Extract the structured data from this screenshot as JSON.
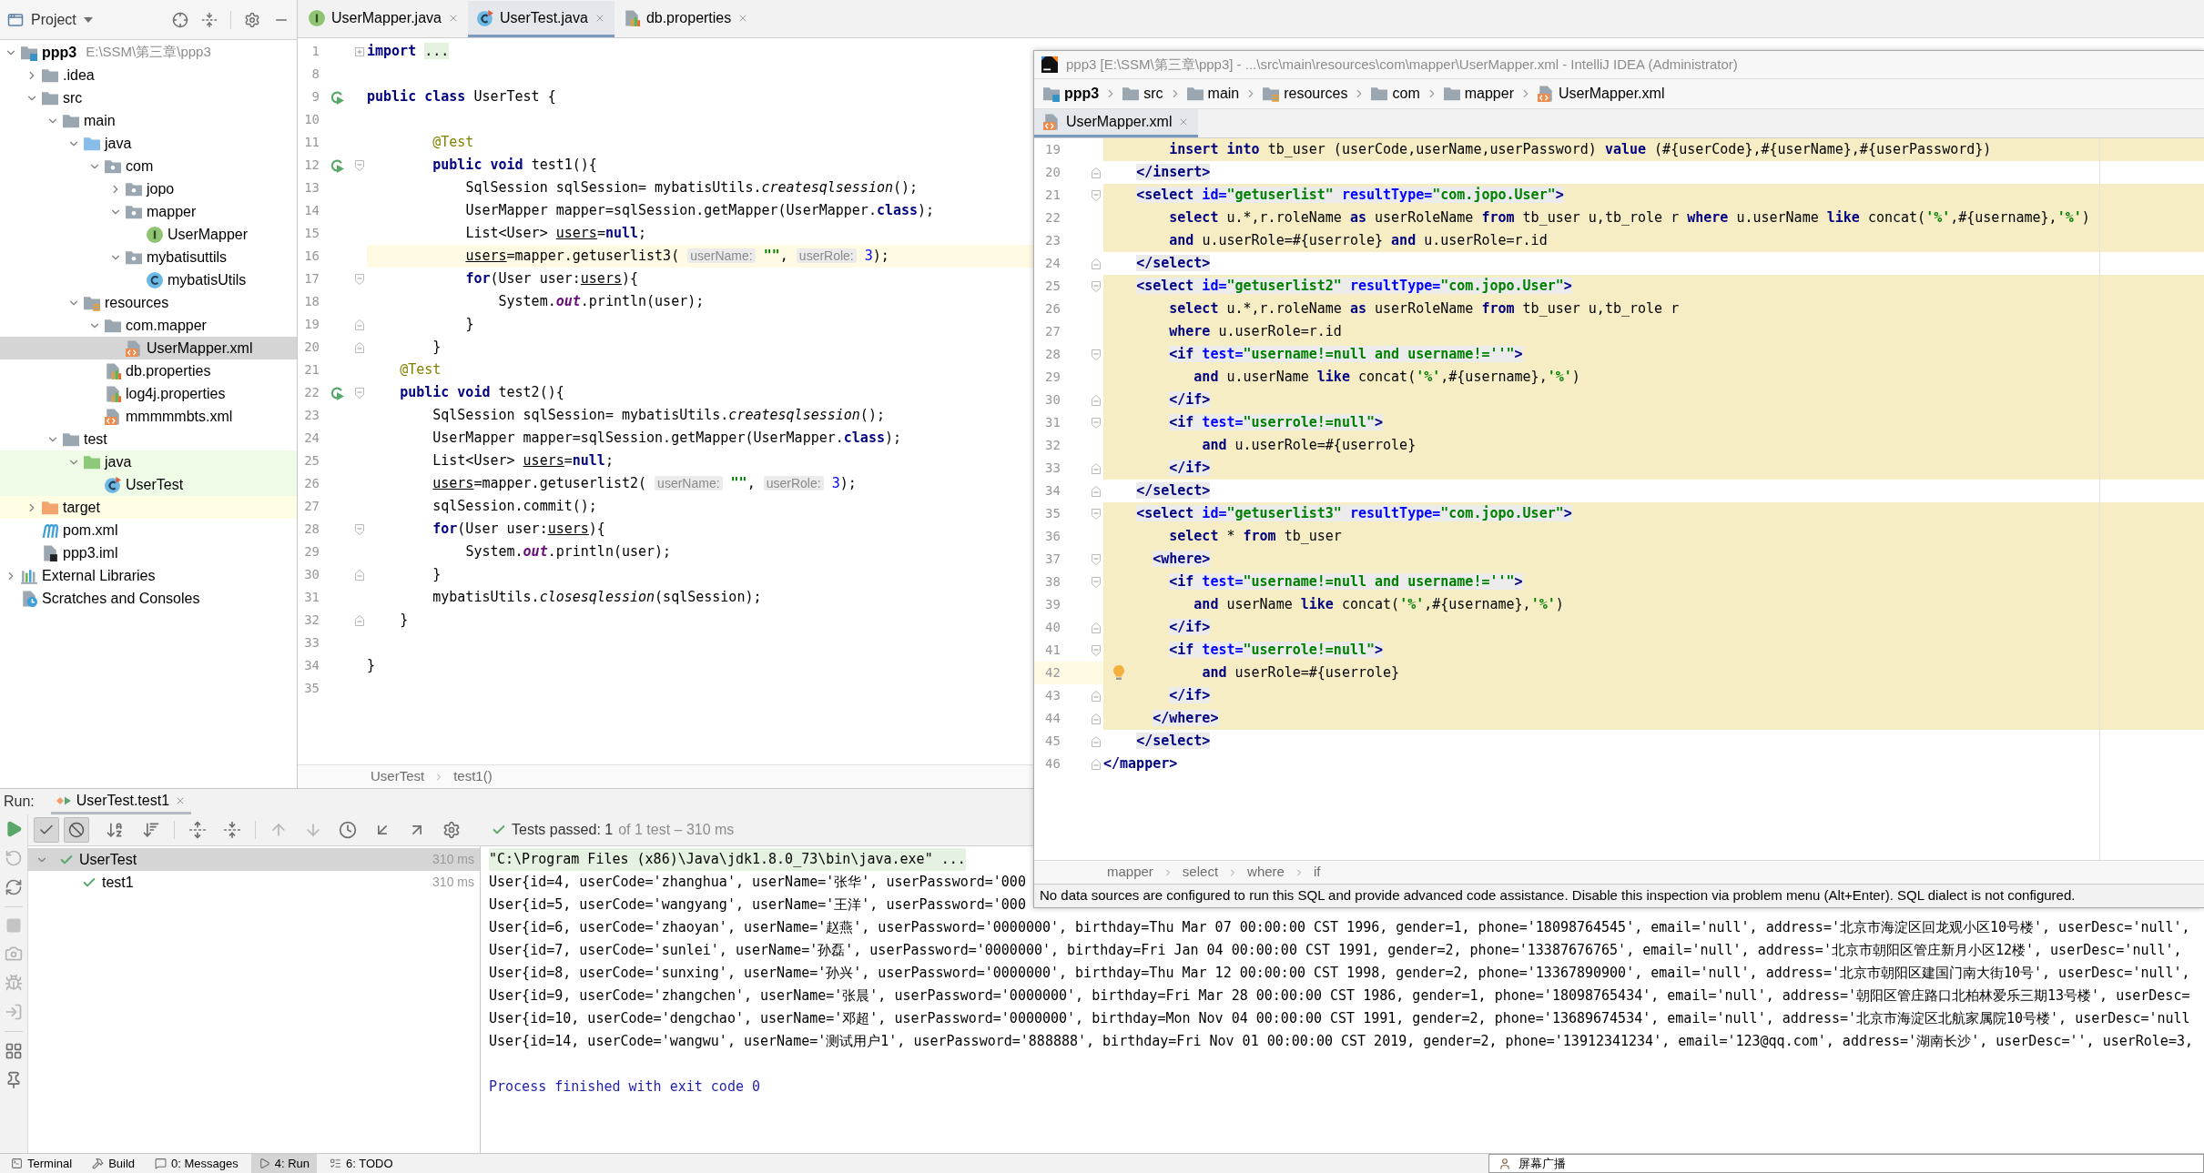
{
  "back_window": {
    "project_panel": {
      "title": "Project",
      "tree": [
        {
          "label": "ppp3",
          "path": "E:\\SSM\\第三章\\ppp3",
          "kind": "module",
          "expanded": true,
          "selected": false,
          "children": [
            {
              "label": ".idea",
              "kind": "folder",
              "expanded": false,
              "selected": false
            },
            {
              "label": "src",
              "kind": "folder",
              "expanded": true,
              "selected": false,
              "children": [
                {
                  "label": "main",
                  "kind": "folder",
                  "expanded": true,
                  "selected": false,
                  "children": [
                    {
                      "label": "java",
                      "kind": "source-root",
                      "expanded": true,
                      "selected": false,
                      "children": [
                        {
                          "label": "com",
                          "kind": "package",
                          "expanded": true,
                          "selected": false,
                          "children": [
                            {
                              "label": "jopo",
                              "kind": "package",
                              "expanded": false,
                              "selected": false
                            },
                            {
                              "label": "mapper",
                              "kind": "package",
                              "expanded": true,
                              "selected": false,
                              "children": [
                                {
                                  "label": "UserMapper",
                                  "kind": "interface",
                                  "selected": false
                                }
                              ]
                            },
                            {
                              "label": "mybatisuttils",
                              "kind": "package",
                              "expanded": true,
                              "selected": false,
                              "children": [
                                {
                                  "label": "mybatisUtils",
                                  "kind": "class",
                                  "selected": false
                                }
                              ]
                            }
                          ]
                        }
                      ]
                    },
                    {
                      "label": "resources",
                      "kind": "resources",
                      "expanded": true,
                      "selected": false,
                      "children": [
                        {
                          "label": "com.mapper",
                          "kind": "folder",
                          "expanded": true,
                          "selected": false,
                          "children": [
                            {
                              "label": "UserMapper.xml",
                              "kind": "xml",
                              "selected": true
                            }
                          ]
                        },
                        {
                          "label": "db.properties",
                          "kind": "properties",
                          "selected": false
                        },
                        {
                          "label": "log4j.properties",
                          "kind": "properties",
                          "selected": false
                        },
                        {
                          "label": "mmmmmbts.xml",
                          "kind": "xml",
                          "selected": false
                        }
                      ]
                    }
                  ]
                },
                {
                  "label": "test",
                  "kind": "folder",
                  "expanded": true,
                  "selected": false,
                  "children": [
                    {
                      "label": "java",
                      "kind": "test-root",
                      "expanded": true,
                      "selected": false,
                      "children": [
                        {
                          "label": "UserTest",
                          "kind": "test-class",
                          "selected": false
                        }
                      ]
                    }
                  ]
                }
              ]
            },
            {
              "label": "target",
              "kind": "excluded",
              "expanded": false,
              "selected": false
            },
            {
              "label": "pom.xml",
              "kind": "maven",
              "selected": false
            },
            {
              "label": "ppp3.iml",
              "kind": "iml",
              "selected": false
            }
          ]
        },
        {
          "label": "External Libraries",
          "kind": "libraries",
          "expanded": false,
          "selected": false
        },
        {
          "label": "Scratches and Consoles",
          "kind": "scratches",
          "selected": false
        }
      ]
    },
    "editor": {
      "tabs": [
        {
          "label": "UserMapper.java",
          "kind": "interface",
          "selected": false
        },
        {
          "label": "UserTest.java",
          "kind": "test-class",
          "selected": true
        },
        {
          "label": "db.properties",
          "kind": "properties",
          "selected": false
        }
      ],
      "lines": [
        {
          "number": "1",
          "current": false,
          "fold_marker": {
            "kind": "collapsed"
          },
          "tokens": [
            {
              "text": "import",
              "kind": "keyword"
            },
            {
              "text": " ...",
              "kind": "folded"
            }
          ]
        },
        {
          "number": "8",
          "current": false
        },
        {
          "number": "9",
          "current": false,
          "gutter_icon": {
            "kind": "run"
          },
          "tokens": [
            {
              "text": "public",
              "kind": "keyword"
            },
            {
              "text": " class",
              "kind": "keyword"
            },
            {
              "text": " UserTest {",
              "kind": "plain"
            }
          ]
        },
        {
          "number": "10",
          "current": false
        },
        {
          "number": "11",
          "current": false,
          "tokens": [
            {
              "text": "        @Test",
              "kind": "annotation"
            }
          ]
        },
        {
          "number": "12",
          "current": false,
          "gutter_icon": {
            "kind": "run"
          },
          "fold_marker": {
            "kind": "start"
          },
          "tokens": [
            {
              "text": "        public",
              "kind": "keyword"
            },
            {
              "text": " void",
              "kind": "keyword"
            },
            {
              "text": " test1(){",
              "kind": "plain"
            }
          ]
        },
        {
          "number": "13",
          "current": false,
          "tokens": [
            {
              "text": "            SqlSession sqlSession= mybatisUtils.",
              "kind": "plain"
            },
            {
              "text": "createsqlsession",
              "kind": "static-call"
            },
            {
              "text": "();",
              "kind": "plain"
            }
          ]
        },
        {
          "number": "14",
          "current": false,
          "tokens": [
            {
              "text": "            UserMapper mapper=sqlSession.getMapper(UserMapper.",
              "kind": "plain"
            },
            {
              "text": "class",
              "kind": "keyword"
            },
            {
              "text": ");",
              "kind": "plain"
            }
          ]
        },
        {
          "number": "15",
          "current": false,
          "tokens": [
            {
              "text": "            List<User> ",
              "kind": "plain"
            },
            {
              "text": "users",
              "kind": "reassigned"
            },
            {
              "text": "=",
              "kind": "plain"
            },
            {
              "text": "null",
              "kind": "keyword"
            },
            {
              "text": ";",
              "kind": "plain"
            }
          ]
        },
        {
          "number": "16",
          "current": true,
          "tokens": [
            {
              "text": "            users",
              "kind": "reassigned"
            },
            {
              "text": "=mapper.getuserlist3(",
              "kind": "plain"
            },
            {
              "text": " userName:",
              "kind": "hint"
            },
            {
              "text": " \"\"",
              "kind": "string"
            },
            {
              "text": ", ",
              "kind": "plain"
            },
            {
              "text": "userRole:",
              "kind": "hint"
            },
            {
              "text": " 3",
              "kind": "number"
            },
            {
              "text": ");",
              "kind": "plain"
            }
          ]
        },
        {
          "number": "17",
          "current": false,
          "fold_marker": {
            "kind": "start"
          },
          "tokens": [
            {
              "text": "            for",
              "kind": "keyword"
            },
            {
              "text": "(User user:",
              "kind": "plain"
            },
            {
              "text": "users",
              "kind": "reassigned"
            },
            {
              "text": "){",
              "kind": "plain"
            }
          ]
        },
        {
          "number": "18",
          "current": false,
          "tokens": [
            {
              "text": "                System.",
              "kind": "plain"
            },
            {
              "text": "out",
              "kind": "static-field"
            },
            {
              "text": ".println(user);",
              "kind": "plain"
            }
          ]
        },
        {
          "number": "19",
          "current": false,
          "fold_marker": {
            "kind": "end"
          },
          "tokens": [
            {
              "text": "            }",
              "kind": "plain"
            }
          ]
        },
        {
          "number": "20",
          "current": false,
          "fold_marker": {
            "kind": "end"
          },
          "tokens": [
            {
              "text": "        }",
              "kind": "plain"
            }
          ]
        },
        {
          "number": "21",
          "current": false,
          "tokens": [
            {
              "text": "    @Test",
              "kind": "annotation"
            }
          ]
        },
        {
          "number": "22",
          "current": false,
          "gutter_icon": {
            "kind": "run"
          },
          "fold_marker": {
            "kind": "start"
          },
          "tokens": [
            {
              "text": "    public",
              "kind": "keyword"
            },
            {
              "text": " void",
              "kind": "keyword"
            },
            {
              "text": " test2(){",
              "kind": "plain"
            }
          ]
        },
        {
          "number": "23",
          "current": false,
          "tokens": [
            {
              "text": "        SqlSession sqlSession= mybatisUtils.",
              "kind": "plain"
            },
            {
              "text": "createsqlsession",
              "kind": "static-call"
            },
            {
              "text": "();",
              "kind": "plain"
            }
          ]
        },
        {
          "number": "24",
          "current": false,
          "tokens": [
            {
              "text": "        UserMapper mapper=sqlSession.getMapper(UserMapper.",
              "kind": "plain"
            },
            {
              "text": "class",
              "kind": "keyword"
            },
            {
              "text": ");",
              "kind": "plain"
            }
          ]
        },
        {
          "number": "25",
          "current": false,
          "tokens": [
            {
              "text": "        List<User> ",
              "kind": "plain"
            },
            {
              "text": "users",
              "kind": "reassigned"
            },
            {
              "text": "=",
              "kind": "plain"
            },
            {
              "text": "null",
              "kind": "keyword"
            },
            {
              "text": ";",
              "kind": "plain"
            }
          ]
        },
        {
          "number": "26",
          "current": false,
          "tokens": [
            {
              "text": "        users",
              "kind": "reassigned"
            },
            {
              "text": "=mapper.getuserlist2(",
              "kind": "plain"
            },
            {
              "text": " userName:",
              "kind": "hint"
            },
            {
              "text": " \"\"",
              "kind": "string"
            },
            {
              "text": ", ",
              "kind": "plain"
            },
            {
              "text": "userRole:",
              "kind": "hint"
            },
            {
              "text": " 3",
              "kind": "number"
            },
            {
              "text": ");",
              "kind": "plain"
            }
          ]
        },
        {
          "number": "27",
          "current": false,
          "tokens": [
            {
              "text": "        sqlSession.commit();",
              "kind": "plain"
            }
          ]
        },
        {
          "number": "28",
          "current": false,
          "fold_marker": {
            "kind": "start"
          },
          "tokens": [
            {
              "text": "        for",
              "kind": "keyword"
            },
            {
              "text": "(User user:",
              "kind": "plain"
            },
            {
              "text": "users",
              "kind": "reassigned"
            },
            {
              "text": "){",
              "kind": "plain"
            }
          ]
        },
        {
          "number": "29",
          "current": false,
          "tokens": [
            {
              "text": "            System.",
              "kind": "plain"
            },
            {
              "text": "out",
              "kind": "static-field"
            },
            {
              "text": ".println(user);",
              "kind": "plain"
            }
          ]
        },
        {
          "number": "30",
          "current": false,
          "fold_marker": {
            "kind": "end"
          },
          "tokens": [
            {
              "text": "        }",
              "kind": "plain"
            }
          ]
        },
        {
          "number": "31",
          "current": false,
          "tokens": [
            {
              "text": "        mybatisUtils.",
              "kind": "plain"
            },
            {
              "text": "closesqlession",
              "kind": "static-call"
            },
            {
              "text": "(sqlSession);",
              "kind": "plain"
            }
          ]
        },
        {
          "number": "32",
          "current": false,
          "fold_marker": {
            "kind": "end"
          },
          "tokens": [
            {
              "text": "    }",
              "kind": "plain"
            }
          ]
        },
        {
          "number": "33",
          "current": false
        },
        {
          "number": "34",
          "current": false,
          "tokens": [
            {
              "text": "}",
              "kind": "plain"
            }
          ]
        },
        {
          "number": "35",
          "current": false
        }
      ],
      "breadcrumbs": [
        "UserTest",
        "test1()"
      ]
    },
    "run_panel": {
      "label": "Run:",
      "tab": {
        "label": "UserTest.test1",
        "selected": true
      },
      "toggles": [
        {
          "pressed": true
        },
        {
          "pressed": true
        }
      ],
      "summary": "Tests passed: 1",
      "summary_detail": "of 1 test – 310 ms",
      "test_tree": [
        {
          "label": "UserTest",
          "time": "310 ms",
          "passed": true,
          "selected": true,
          "expanded": true,
          "children": [
            {
              "label": "test1",
              "time": "310 ms",
              "passed": true,
              "selected": false
            }
          ]
        }
      ],
      "console": [
        {
          "kind": "command",
          "text": "\"C:\\Program Files (x86)\\Java\\jdk1.8.0_73\\bin\\java.exe\" ..."
        },
        {
          "kind": "output",
          "text": "User{id=4, userCode='zhanghua', userName='张华', userPassword='000"
        },
        {
          "kind": "output",
          "text": "User{id=5, userCode='wangyang', userName='王洋', userPassword='000"
        },
        {
          "kind": "output",
          "text": "User{id=6, userCode='zhaoyan', userName='赵燕', userPassword='0000000', birthday=Thu Mar 07 00:00:00 CST 1996, gender=1, phone='18098764545', email='null', address='北京市海淀区回龙观小区10号楼', userDesc='null',"
        },
        {
          "kind": "output",
          "text": "User{id=7, userCode='sunlei', userName='孙磊', userPassword='0000000', birthday=Fri Jan 04 00:00:00 CST 1991, gender=2, phone='13387676765', email='null', address='北京市朝阳区管庄新月小区12楼', userDesc='null',"
        },
        {
          "kind": "output",
          "text": "User{id=8, userCode='sunxing', userName='孙兴', userPassword='0000000', birthday=Thu Mar 12 00:00:00 CST 1998, gender=2, phone='13367890900', email='null', address='北京市朝阳区建国门南大街10号', userDesc='null',"
        },
        {
          "kind": "output",
          "text": "User{id=9, userCode='zhangchen', userName='张晨', userPassword='0000000', birthday=Fri Mar 28 00:00:00 CST 1986, gender=1, phone='18098765434', email='null', address='朝阳区管庄路口北柏林爱乐三期13号楼', userDesc="
        },
        {
          "kind": "output",
          "text": "User{id=10, userCode='dengchao', userName='邓超', userPassword='0000000', birthday=Mon Nov 04 00:00:00 CST 1991, gender=2, phone='13689674534', email='null', address='北京市海淀区北航家属院10号楼', userDesc='null"
        },
        {
          "kind": "output",
          "text": "User{id=14, userCode='wangwu', userName='测试用户1', userPassword='888888', birthday=Fri Nov 01 00:00:00 CST 2019, gender=2, phone='13912341234', email='123@qq.com', address='湖南长沙', userDesc='', userRole=3,"
        },
        {
          "kind": "exit",
          "text": "Process finished with exit code 0"
        }
      ]
    },
    "tool_windows": [
      {
        "label": "Terminal",
        "selected": false
      },
      {
        "label": "Build",
        "selected": false
      },
      {
        "label": "0: Messages",
        "selected": false
      },
      {
        "label": "4: Run",
        "selected": true
      },
      {
        "label": "6: TODO",
        "selected": false
      }
    ]
  },
  "front_window": {
    "title": "ppp3 [E:\\SSM\\第三章\\ppp3] - ...\\src\\main\\resources\\com\\mapper\\UserMapper.xml - IntelliJ IDEA (Administrator)",
    "nav_path": [
      {
        "label": "ppp3",
        "kind": "module"
      },
      {
        "label": "src",
        "kind": "folder"
      },
      {
        "label": "main",
        "kind": "folder"
      },
      {
        "label": "resources",
        "kind": "resources"
      },
      {
        "label": "com",
        "kind": "folder"
      },
      {
        "label": "mapper",
        "kind": "folder"
      },
      {
        "label": "UserMapper.xml",
        "kind": "xml"
      }
    ],
    "tabs": [
      {
        "label": "UserMapper.xml",
        "kind": "xml",
        "selected": true
      }
    ],
    "lines": [
      {
        "number": "19",
        "current": false,
        "injected": true,
        "tokens": [
          {
            "text": "        insert into",
            "kind": "sql"
          },
          {
            "text": " tb_user (userCode,userName,userPassword) ",
            "kind": "plain"
          },
          {
            "text": "value",
            "kind": "sql"
          },
          {
            "text": " (#{userCode},#{userName},#{userPassword})",
            "kind": "plain"
          }
        ]
      },
      {
        "number": "20",
        "current": false,
        "injected": false,
        "fold_marker": {
          "kind": "end"
        },
        "tokens": [
          {
            "text": "    </insert>",
            "kind": "tag"
          }
        ]
      },
      {
        "number": "21",
        "current": false,
        "injected": true,
        "fold_marker": {
          "kind": "start"
        },
        "tokens": [
          {
            "text": "    <select",
            "kind": "tag"
          },
          {
            "text": " id=",
            "kind": "attr"
          },
          {
            "text": "\"getuserlist\"",
            "kind": "value"
          },
          {
            "text": " resultType=",
            "kind": "attr"
          },
          {
            "text": "\"com.jopo.User\"",
            "kind": "value"
          },
          {
            "text": ">",
            "kind": "tag"
          }
        ]
      },
      {
        "number": "22",
        "current": false,
        "injected": true,
        "tokens": [
          {
            "text": "        select",
            "kind": "sql"
          },
          {
            "text": " u.*,r.roleName ",
            "kind": "plain"
          },
          {
            "text": "as",
            "kind": "sql"
          },
          {
            "text": " userRoleName ",
            "kind": "plain"
          },
          {
            "text": "from",
            "kind": "sql"
          },
          {
            "text": " tb_user u,tb_role r ",
            "kind": "plain"
          },
          {
            "text": "where",
            "kind": "sql"
          },
          {
            "text": " u.userName ",
            "kind": "plain"
          },
          {
            "text": "like",
            "kind": "sql"
          },
          {
            "text": " concat(",
            "kind": "plain"
          },
          {
            "text": "'%'",
            "kind": "sql-string"
          },
          {
            "text": ",#{username},",
            "kind": "plain"
          },
          {
            "text": "'%'",
            "kind": "sql-string"
          },
          {
            "text": ")",
            "kind": "plain"
          }
        ]
      },
      {
        "number": "23",
        "current": false,
        "injected": true,
        "tokens": [
          {
            "text": "        and",
            "kind": "sql"
          },
          {
            "text": " u.userRole=#{userrole} ",
            "kind": "plain"
          },
          {
            "text": "and",
            "kind": "sql"
          },
          {
            "text": " u.userRole=r.id",
            "kind": "plain"
          }
        ]
      },
      {
        "number": "24",
        "current": false,
        "injected": false,
        "fold_marker": {
          "kind": "end"
        },
        "tokens": [
          {
            "text": "    </select>",
            "kind": "tag"
          }
        ]
      },
      {
        "number": "25",
        "current": false,
        "injected": true,
        "fold_marker": {
          "kind": "start"
        },
        "tokens": [
          {
            "text": "    <select",
            "kind": "tag"
          },
          {
            "text": " id=",
            "kind": "attr"
          },
          {
            "text": "\"getuserlist2\"",
            "kind": "value"
          },
          {
            "text": " resultType=",
            "kind": "attr"
          },
          {
            "text": "\"com.jopo.User\"",
            "kind": "value"
          },
          {
            "text": ">",
            "kind": "tag"
          }
        ]
      },
      {
        "number": "26",
        "current": false,
        "injected": true,
        "tokens": [
          {
            "text": "        select",
            "kind": "sql"
          },
          {
            "text": " u.*,r.roleName ",
            "kind": "plain"
          },
          {
            "text": "as",
            "kind": "sql"
          },
          {
            "text": " userRoleName ",
            "kind": "plain"
          },
          {
            "text": "from",
            "kind": "sql"
          },
          {
            "text": " tb_user u,tb_role r",
            "kind": "plain"
          }
        ]
      },
      {
        "number": "27",
        "current": false,
        "injected": true,
        "tokens": [
          {
            "text": "        where",
            "kind": "sql"
          },
          {
            "text": " u.userRole=r.id",
            "kind": "plain"
          }
        ]
      },
      {
        "number": "28",
        "current": false,
        "injected": true,
        "fold_marker": {
          "kind": "start"
        },
        "tokens": [
          {
            "text": "        <if",
            "kind": "tag"
          },
          {
            "text": " test=",
            "kind": "attr"
          },
          {
            "text": "\"username!=null and username!=''\"",
            "kind": "value"
          },
          {
            "text": ">",
            "kind": "tag"
          }
        ]
      },
      {
        "number": "29",
        "current": false,
        "injected": true,
        "tokens": [
          {
            "text": "           and",
            "kind": "sql"
          },
          {
            "text": " u.userName ",
            "kind": "plain"
          },
          {
            "text": "like",
            "kind": "sql"
          },
          {
            "text": " concat(",
            "kind": "plain"
          },
          {
            "text": "'%'",
            "kind": "sql-string"
          },
          {
            "text": ",#{username},",
            "kind": "plain"
          },
          {
            "text": "'%'",
            "kind": "sql-string"
          },
          {
            "text": ")",
            "kind": "plain"
          }
        ]
      },
      {
        "number": "30",
        "current": false,
        "injected": true,
        "fold_marker": {
          "kind": "end"
        },
        "tokens": [
          {
            "text": "        </if>",
            "kind": "tag"
          }
        ]
      },
      {
        "number": "31",
        "current": false,
        "injected": true,
        "fold_marker": {
          "kind": "start"
        },
        "tokens": [
          {
            "text": "        <if",
            "kind": "tag"
          },
          {
            "text": " test=",
            "kind": "attr"
          },
          {
            "text": "\"userrole!=null\"",
            "kind": "value"
          },
          {
            "text": ">",
            "kind": "tag"
          }
        ]
      },
      {
        "number": "32",
        "current": false,
        "injected": true,
        "tokens": [
          {
            "text": "            and",
            "kind": "sql"
          },
          {
            "text": " u.userRole=#{userrole}",
            "kind": "plain"
          }
        ]
      },
      {
        "number": "33",
        "current": false,
        "injected": true,
        "fold_marker": {
          "kind": "end"
        },
        "tokens": [
          {
            "text": "        </if>",
            "kind": "tag"
          }
        ]
      },
      {
        "number": "34",
        "current": false,
        "injected": false,
        "fold_marker": {
          "kind": "end"
        },
        "tokens": [
          {
            "text": "    </select>",
            "kind": "tag"
          }
        ]
      },
      {
        "number": "35",
        "current": false,
        "injected": true,
        "fold_marker": {
          "kind": "start"
        },
        "tokens": [
          {
            "text": "    <select",
            "kind": "tag"
          },
          {
            "text": " id=",
            "kind": "attr"
          },
          {
            "text": "\"getuserlist3\"",
            "kind": "value"
          },
          {
            "text": " resultType=",
            "kind": "attr"
          },
          {
            "text": "\"com.jopo.User\"",
            "kind": "value"
          },
          {
            "text": ">",
            "kind": "tag"
          }
        ]
      },
      {
        "number": "36",
        "current": false,
        "injected": true,
        "tokens": [
          {
            "text": "        select",
            "kind": "sql"
          },
          {
            "text": " * ",
            "kind": "plain"
          },
          {
            "text": "from",
            "kind": "sql"
          },
          {
            "text": " tb_user",
            "kind": "plain"
          }
        ]
      },
      {
        "number": "37",
        "current": false,
        "injected": true,
        "fold_marker": {
          "kind": "start"
        },
        "tokens": [
          {
            "text": "      <where>",
            "kind": "tag"
          }
        ]
      },
      {
        "number": "38",
        "current": false,
        "injected": true,
        "fold_marker": {
          "kind": "start"
        },
        "tokens": [
          {
            "text": "        <if",
            "kind": "tag"
          },
          {
            "text": " test=",
            "kind": "attr"
          },
          {
            "text": "\"username!=null and username!=''\"",
            "kind": "value"
          },
          {
            "text": ">",
            "kind": "tag"
          }
        ]
      },
      {
        "number": "39",
        "current": false,
        "injected": true,
        "tokens": [
          {
            "text": "           and",
            "kind": "sql"
          },
          {
            "text": " userName ",
            "kind": "plain"
          },
          {
            "text": "like",
            "kind": "sql"
          },
          {
            "text": " concat(",
            "kind": "plain"
          },
          {
            "text": "'%'",
            "kind": "sql-string"
          },
          {
            "text": ",#{username},",
            "kind": "plain"
          },
          {
            "text": "'%'",
            "kind": "sql-string"
          },
          {
            "text": ")",
            "kind": "plain"
          }
        ]
      },
      {
        "number": "40",
        "current": false,
        "injected": true,
        "fold_marker": {
          "kind": "end"
        },
        "tokens": [
          {
            "text": "        </if>",
            "kind": "tag"
          }
        ]
      },
      {
        "number": "41",
        "current": false,
        "injected": true,
        "fold_marker": {
          "kind": "start"
        },
        "tokens": [
          {
            "text": "        <if",
            "kind": "tag"
          },
          {
            "text": " test=",
            "kind": "attr"
          },
          {
            "text": "\"userrole!=null\"",
            "kind": "value"
          },
          {
            "text": ">",
            "kind": "tag"
          }
        ]
      },
      {
        "number": "42",
        "current": true,
        "injected": true,
        "gutter_icon": {
          "kind": "bulb"
        },
        "tokens": [
          {
            "text": "            and",
            "kind": "sql"
          },
          {
            "text": " userRole=#{userrole}",
            "kind": "plain"
          }
        ]
      },
      {
        "number": "43",
        "current": false,
        "injected": true,
        "fold_marker": {
          "kind": "end"
        },
        "tokens": [
          {
            "text": "        </if>",
            "kind": "tag"
          }
        ]
      },
      {
        "number": "44",
        "current": false,
        "injected": true,
        "fold_marker": {
          "kind": "end"
        },
        "tokens": [
          {
            "text": "      </where>",
            "kind": "tag"
          }
        ]
      },
      {
        "number": "45",
        "current": false,
        "injected": false,
        "fold_marker": {
          "kind": "end"
        },
        "tokens": [
          {
            "text": "    </select>",
            "kind": "tag"
          }
        ]
      },
      {
        "number": "46",
        "current": false,
        "injected": false,
        "fold_marker": {
          "kind": "end"
        },
        "tokens": [
          {
            "text": "</mapper>",
            "kind": "root-tag"
          }
        ]
      }
    ],
    "breadcrumbs": [
      "mapper",
      "select",
      "where",
      "if"
    ],
    "notice": "No data sources are configured to run this SQL and provide advanced code assistance. Disable this inspection via problem menu (Alt+Enter). SQL dialect is not configured."
  },
  "broadcast_window": {
    "title": "屏幕广播"
  }
}
